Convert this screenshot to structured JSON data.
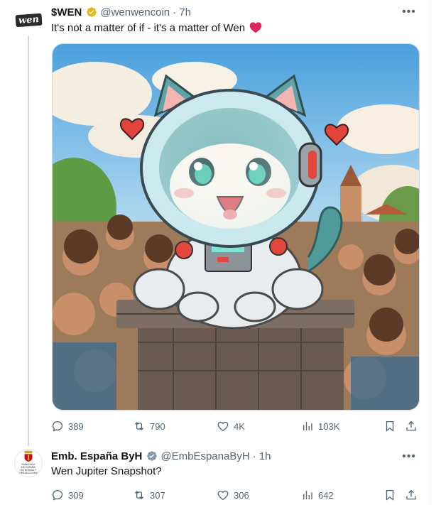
{
  "tweet1": {
    "name": "$WEN",
    "handle": "@wenwencoin",
    "time": "· 7h",
    "text": "It's not a matter of if - it's a matter of Wen",
    "avatar_text": "wen",
    "stats": {
      "replies": "389",
      "retweets": "790",
      "likes": "4K",
      "views": "103K"
    }
  },
  "tweet2": {
    "name": "Emb. España ByH",
    "handle": "@EmbEspanaByH",
    "time": "· 1h",
    "text": "Wen Jupiter Snapshot?",
    "avatar_text": [
      "EMBAJADA",
      "DE ESPAÑA",
      "EN BOSNIA Y",
      "HERZEGOVINA"
    ],
    "stats": {
      "replies": "309",
      "retweets": "307",
      "likes": "306",
      "views": "642"
    }
  },
  "icons": {
    "verified_gold": "#e2b719",
    "verified_grey": "#829aab",
    "emoji_heart": "#f4245e"
  }
}
